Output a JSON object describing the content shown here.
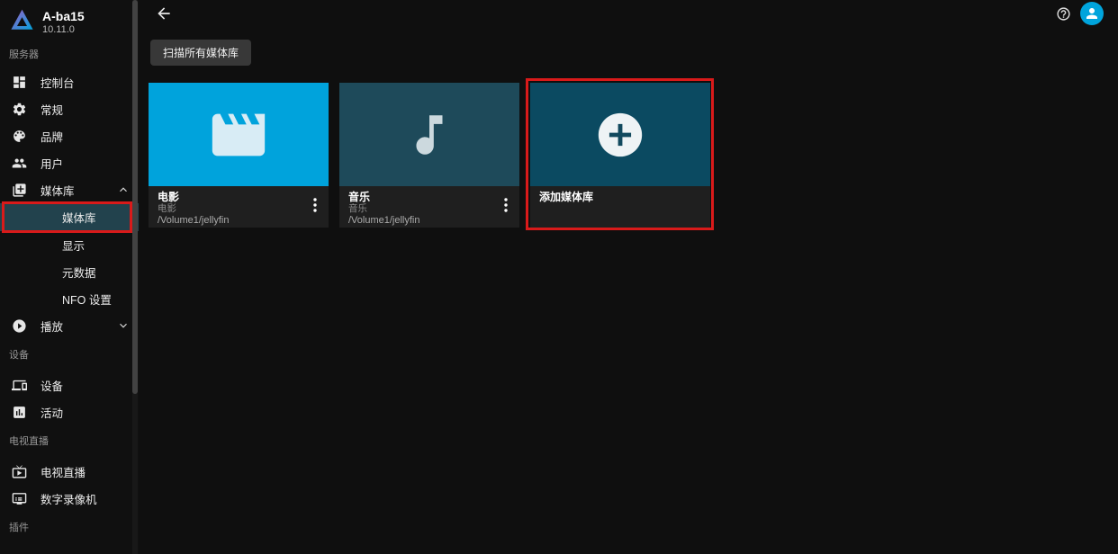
{
  "app": {
    "name": "A-ba15",
    "version": "10.11.0",
    "logo_icon": "jellyfin-triangle"
  },
  "colors": {
    "accent": "#00a4dc",
    "active_item_bg": "#22424d",
    "annotation_red": "#d91a1a",
    "card_footer_bg": "#1f1f1f",
    "scan_button_bg": "#383838",
    "background": "#0f0f0f"
  },
  "sidebar": {
    "groups": [
      {
        "label": "服务器",
        "items": [
          {
            "label": "控制台",
            "icon": "dashboard-icon"
          },
          {
            "label": "常规",
            "icon": "gear-icon"
          },
          {
            "label": "品牌",
            "icon": "palette-icon"
          },
          {
            "label": "用户",
            "icon": "users-icon"
          },
          {
            "label": "媒体库",
            "icon": "library-add-icon",
            "state": "expanded",
            "chevron": "chevron-up-icon"
          },
          {
            "label": "媒体库",
            "sub": true,
            "active": true,
            "annotated": true
          },
          {
            "label": "显示",
            "sub": true
          },
          {
            "label": "元数据",
            "sub": true
          },
          {
            "label": "NFO 设置",
            "sub": true
          },
          {
            "label": "播放",
            "icon": "play-circle-icon",
            "state": "collapsed",
            "chevron": "chevron-down-icon"
          }
        ]
      },
      {
        "label": "设备",
        "items": [
          {
            "label": "设备",
            "icon": "devices-icon"
          },
          {
            "label": "活动",
            "icon": "activity-chart-icon"
          }
        ]
      },
      {
        "label": "电视直播",
        "items": [
          {
            "label": "电视直播",
            "icon": "live-tv-icon"
          },
          {
            "label": "数字录像机",
            "icon": "dvr-icon"
          }
        ]
      },
      {
        "label": "插件",
        "items": []
      }
    ]
  },
  "header": {
    "left_icon": "back-arrow-icon",
    "right_icons": [
      "help-icon",
      "user-avatar-icon"
    ]
  },
  "toolbar": {
    "scan_all_label": "扫描所有媒体库"
  },
  "libraries": {
    "cards": [
      {
        "title": "电影",
        "subtitle": "电影",
        "path": "/Volume1/jellyfin",
        "tile_color": "#00a3dc",
        "icon": "movie-icon",
        "menu": "kebab-menu-icon"
      },
      {
        "title": "音乐",
        "subtitle": "音乐",
        "path": "/Volume1/jellyfin",
        "tile_color": "#1e4a5a",
        "icon": "music-note-icon",
        "menu": "kebab-menu-icon"
      },
      {
        "title": "添加媒体库",
        "tile_color": "#0b4a61",
        "icon": "plus-circle-icon",
        "annotated": true
      }
    ]
  },
  "annotations": {
    "color": "#d91a1a",
    "targets": [
      "sidebar-item-libraries-sub",
      "add-library-card"
    ]
  }
}
